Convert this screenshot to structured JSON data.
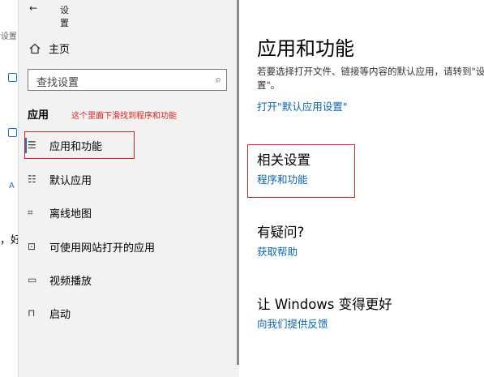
{
  "background_window": {
    "fragments": [
      "]设置",
      "A",
      "，好"
    ]
  },
  "nav": {
    "back_icon": "←",
    "title": "设置",
    "home": {
      "icon": "home-icon",
      "label": "主页"
    },
    "search": {
      "placeholder": "查找设置",
      "icon": "⌕"
    },
    "section": "应用",
    "annotation": "这个里面下滑找到程序和功能",
    "items": [
      {
        "label": "应用和功能",
        "icon": "☰"
      },
      {
        "label": "默认应用",
        "icon": "☷"
      },
      {
        "label": "离线地图",
        "icon": "⌗"
      },
      {
        "label": "可使用网站打开的应用",
        "icon": "⊡"
      },
      {
        "label": "视频播放",
        "icon": "▭"
      },
      {
        "label": "启动",
        "icon": "⊓"
      }
    ]
  },
  "main": {
    "title": "应用和功能",
    "description": "若要选择打开文件、链接等内容的默认应用，请转到\"设置\"。",
    "default_settings_link": "打开\"默认应用设置\"",
    "related": {
      "heading": "相关设置",
      "link": "程序和功能"
    },
    "question": {
      "heading": "有疑问?",
      "link": "获取帮助"
    },
    "feedback": {
      "heading": "让 Windows 变得更好",
      "link": "向我们提供反馈"
    }
  },
  "colors": {
    "accent": "#0a64b4",
    "annotation": "#e02020",
    "nav_bg": "#f2f2f2"
  }
}
